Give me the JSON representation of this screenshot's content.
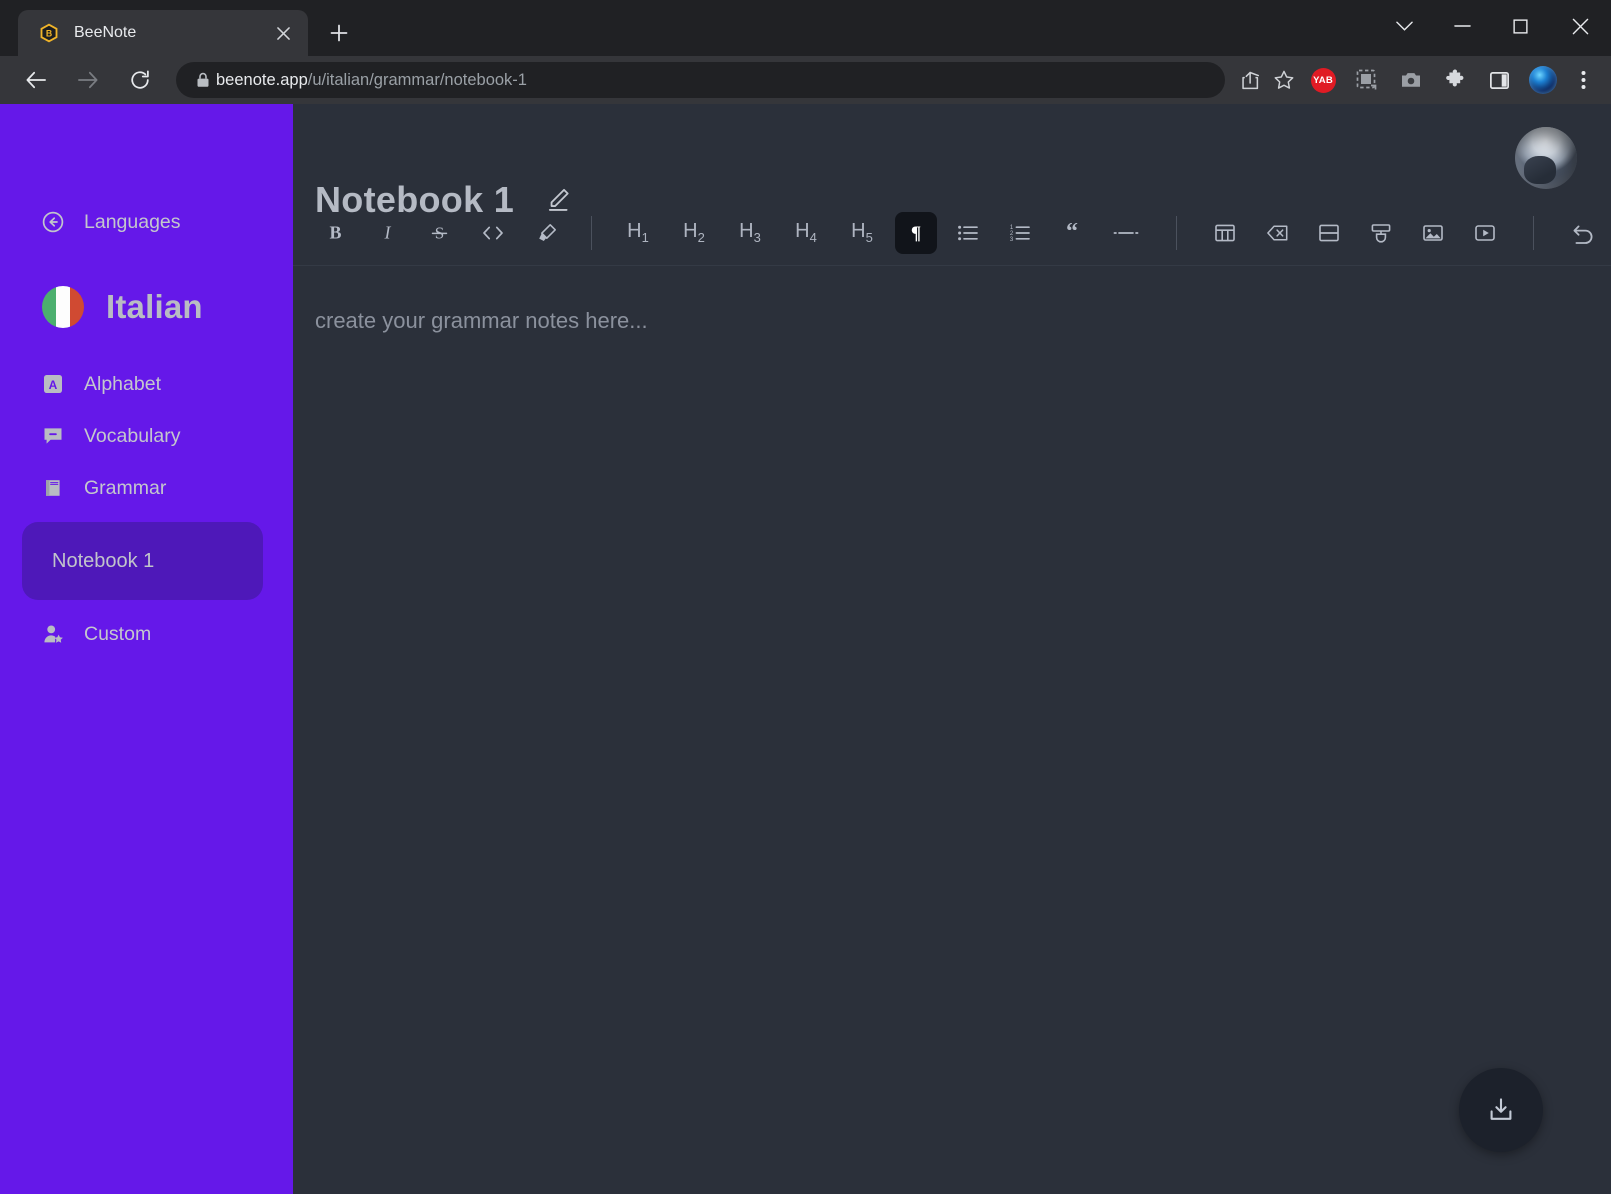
{
  "browser": {
    "tab": {
      "title": "BeeNote",
      "favicon_icon": "beenote-hexagon-icon",
      "close_icon": "close-icon"
    },
    "new_tab_label": "+",
    "window_controls": [
      {
        "name": "tab-search",
        "icon": "chevron-down-icon"
      },
      {
        "name": "minimize",
        "icon": "minimize-icon"
      },
      {
        "name": "maximize",
        "icon": "maximize-icon"
      },
      {
        "name": "close",
        "icon": "close-icon"
      }
    ],
    "nav": {
      "back_icon": "arrow-left-icon",
      "forward_icon": "arrow-right-icon",
      "reload_icon": "reload-icon"
    },
    "omnibox": {
      "lock_icon": "lock-icon",
      "host": "beenote.app",
      "path": "/u/italian/grammar/notebook-1",
      "share_icon": "share-icon",
      "bookmark_icon": "star-icon"
    },
    "extensions": [
      {
        "name": "yab-extension",
        "label": "YAB",
        "color": "#e01b24"
      },
      {
        "name": "screenshot-region-extension",
        "icon": "dashed-square-icon"
      },
      {
        "name": "camera-extension",
        "icon": "camera-icon"
      },
      {
        "name": "extensions-puzzle",
        "icon": "puzzle-icon"
      },
      {
        "name": "side-panel",
        "icon": "panel-icon"
      },
      {
        "name": "browser-profile",
        "icon": "profile-avatar-icon"
      }
    ],
    "menu_icon": "kebab-menu-icon"
  },
  "sidebar": {
    "background_color": "#6518e9",
    "active_color": "#4e18b9",
    "back": {
      "label": "Languages",
      "icon": "circle-arrow-left-icon"
    },
    "language": {
      "name": "Italian",
      "flag_icon": "italy-flag-icon"
    },
    "items": [
      {
        "label": "Alphabet",
        "icon": "letter-a-square-icon"
      },
      {
        "label": "Vocabulary",
        "icon": "chat-bubble-icon"
      },
      {
        "label": "Grammar",
        "icon": "book-icon"
      }
    ],
    "notebook": {
      "label": "Notebook 1"
    },
    "custom": {
      "label": "Custom",
      "icon": "person-star-icon"
    }
  },
  "main": {
    "user_avatar_icon": "user-avatar",
    "title": "Notebook 1",
    "edit_icon": "pencil-icon",
    "toolbar": {
      "groups": [
        [
          {
            "name": "bold",
            "glyph": "B",
            "icon": "bold-icon",
            "active": false
          },
          {
            "name": "italic",
            "glyph": "I",
            "icon": "italic-icon",
            "active": false
          },
          {
            "name": "strikethrough",
            "glyph": "S",
            "icon": "strikethrough-icon",
            "active": false
          },
          {
            "name": "code",
            "glyph": "<>",
            "icon": "code-icon",
            "active": false
          },
          {
            "name": "highlight",
            "glyph": "",
            "icon": "highlighter-icon",
            "active": false
          }
        ],
        [
          {
            "name": "heading-1",
            "glyph": "H1",
            "icon": "h1-icon",
            "active": false
          },
          {
            "name": "heading-2",
            "glyph": "H2",
            "icon": "h2-icon",
            "active": false
          },
          {
            "name": "heading-3",
            "glyph": "H3",
            "icon": "h3-icon",
            "active": false
          },
          {
            "name": "heading-4",
            "glyph": "H4",
            "icon": "h4-icon",
            "active": false
          },
          {
            "name": "heading-5",
            "glyph": "H5",
            "icon": "h5-icon",
            "active": false
          },
          {
            "name": "paragraph",
            "glyph": "¶",
            "icon": "paragraph-icon",
            "active": true
          },
          {
            "name": "bullet-list",
            "glyph": "",
            "icon": "bullet-list-icon",
            "active": false
          },
          {
            "name": "ordered-list",
            "glyph": "",
            "icon": "ordered-list-icon",
            "active": false
          },
          {
            "name": "blockquote",
            "glyph": "“",
            "icon": "quote-icon",
            "active": false
          },
          {
            "name": "horizontal-rule",
            "glyph": "",
            "icon": "horizontal-rule-icon",
            "active": false
          }
        ],
        [
          {
            "name": "insert-table",
            "icon": "table-icon",
            "active": false
          },
          {
            "name": "delete-table",
            "icon": "delete-table-icon",
            "active": false
          },
          {
            "name": "split-cell",
            "icon": "split-cell-icon",
            "active": false
          },
          {
            "name": "cell-options",
            "icon": "cell-options-icon",
            "active": false
          },
          {
            "name": "insert-image",
            "icon": "image-icon",
            "active": false
          },
          {
            "name": "insert-video",
            "icon": "video-icon",
            "active": false
          }
        ],
        [
          {
            "name": "undo",
            "icon": "undo-icon",
            "active": false
          },
          {
            "name": "redo",
            "icon": "redo-icon",
            "active": false
          }
        ]
      ]
    },
    "editor": {
      "placeholder": "create your grammar notes here..."
    },
    "download_button": {
      "icon": "download-icon"
    }
  }
}
